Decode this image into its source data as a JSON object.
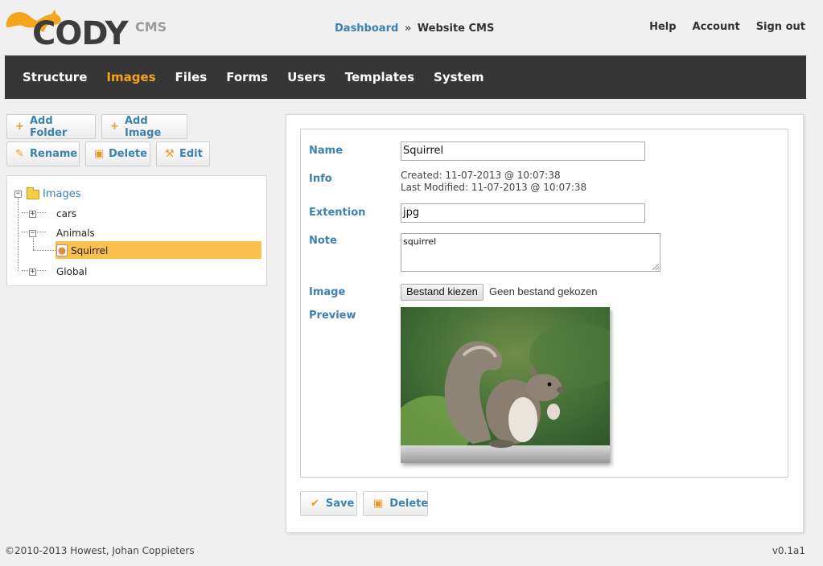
{
  "header": {
    "logo_text": "CODY",
    "logo_suffix": "CMS",
    "breadcrumb": {
      "link": "Dashboard",
      "separator": "»",
      "current": "Website CMS"
    },
    "links": [
      "Help",
      "Account",
      "Sign out"
    ]
  },
  "nav": {
    "items": [
      "Structure",
      "Images",
      "Files",
      "Forms",
      "Users",
      "Templates",
      "System"
    ],
    "active": "Images"
  },
  "toolbar": {
    "add_folder": "Add Folder",
    "add_image": "Add Image",
    "rename": "Rename",
    "delete": "Delete",
    "edit": "Edit"
  },
  "tree": {
    "root": "Images",
    "items": [
      "cars",
      "Animals",
      "Squirrel",
      "Global"
    ],
    "selected": "Squirrel"
  },
  "form": {
    "name_label": "Name",
    "name_value": "Squirrel",
    "info_label": "Info",
    "info_created": "Created: 11-07-2013 @ 10:07:38",
    "info_modified": "Last Modified: 11-07-2013 @ 10:07:38",
    "extension_label": "Extention",
    "extension_value": "jpg",
    "note_label": "Note",
    "note_value": "squirrel",
    "image_label": "Image",
    "file_button": "Bestand kiezen",
    "file_status": "Geen bestand gekozen",
    "preview_label": "Preview"
  },
  "actions": {
    "save": "Save",
    "delete": "Delete"
  },
  "footer": {
    "copyright": "©2010-2013 Howest, Johan Coppieters",
    "version": "v0.1a1"
  },
  "colors": {
    "accent": "#f7a21b",
    "link": "#3c82b0",
    "navbar": "#363636",
    "selection": "#fbc04e"
  }
}
